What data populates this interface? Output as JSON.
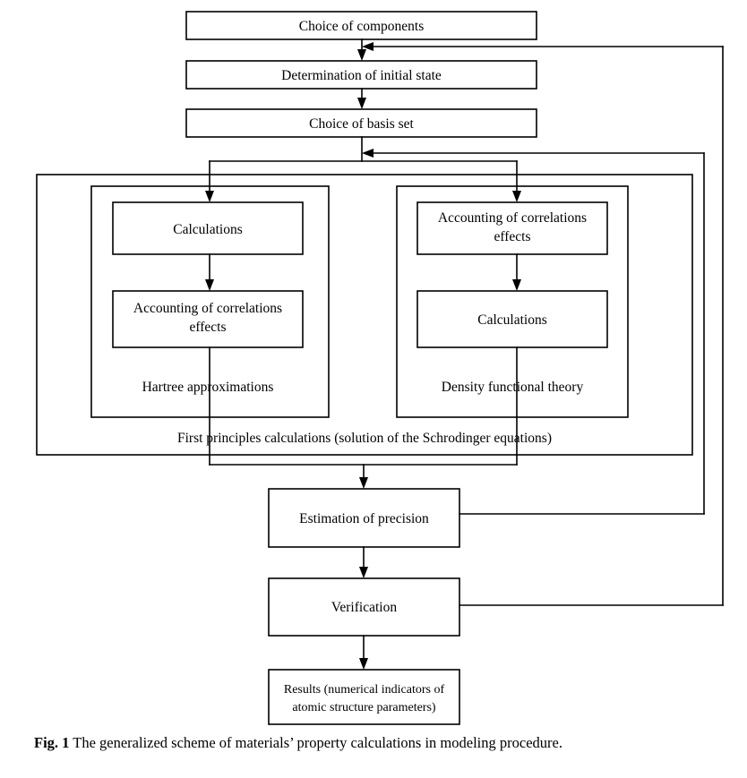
{
  "figure": {
    "caption_label": "Fig. 1",
    "caption_text": "The generalized scheme of materials’ property calculations in modeling procedure."
  },
  "nodes": {
    "choice_of_components": "Choice of components",
    "determination_of_initial_state": "Determination of initial state",
    "choice_of_basis_set": "Choice of basis set",
    "hartree_calculations": "Calculations",
    "hartree_correlations_line1": "Accounting of correlations",
    "hartree_correlations_line2": "effects",
    "dft_correlations_line1": "Accounting of correlations",
    "dft_correlations_line2": "effects",
    "dft_calculations": "Calculations",
    "estimation_of_precision": "Estimation of precision",
    "verification": "Verification",
    "results_line1": "Results (numerical indicators of",
    "results_line2": "atomic structure parameters)"
  },
  "panels": {
    "hartree_label": "Hartree approximations",
    "dft_label": "Density functional theory",
    "first_principles_label": "First principles calculations (solution of the Schrodinger equations)"
  },
  "chart_data": {
    "type": "diagram",
    "diagram_kind": "flowchart",
    "title": "The generalized scheme of materials’ property calculations in modeling procedure",
    "nodes": [
      {
        "id": "choice_of_components",
        "label": "Choice of components",
        "shape": "rect"
      },
      {
        "id": "determination_of_initial_state",
        "label": "Determination of initial state",
        "shape": "rect"
      },
      {
        "id": "choice_of_basis_set",
        "label": "Choice of basis set",
        "shape": "rect"
      },
      {
        "id": "hartree_calculations",
        "label": "Calculations",
        "shape": "rect",
        "group": "Hartree approximations"
      },
      {
        "id": "hartree_correlations",
        "label": "Accounting of correlations effects",
        "shape": "rect",
        "group": "Hartree approximations"
      },
      {
        "id": "dft_correlations",
        "label": "Accounting of correlations effects",
        "shape": "rect",
        "group": "Density functional theory"
      },
      {
        "id": "dft_calculations",
        "label": "Calculations",
        "shape": "rect",
        "group": "Density functional theory"
      },
      {
        "id": "estimation_of_precision",
        "label": "Estimation of precision",
        "shape": "rect"
      },
      {
        "id": "verification",
        "label": "Verification",
        "shape": "rect"
      },
      {
        "id": "results",
        "label": "Results (numerical indicators of atomic structure parameters)",
        "shape": "rect"
      }
    ],
    "groups": [
      {
        "id": "hartree",
        "label": "Hartree approximations"
      },
      {
        "id": "dft",
        "label": "Density functional theory"
      },
      {
        "id": "first_principles",
        "label": "First principles calculations (solution of the Schrodinger equations)",
        "contains": [
          "hartree",
          "dft"
        ]
      }
    ],
    "edges": [
      {
        "from": "choice_of_components",
        "to": "determination_of_initial_state",
        "kind": "arrow"
      },
      {
        "from": "determination_of_initial_state",
        "to": "choice_of_basis_set",
        "kind": "arrow"
      },
      {
        "from": "choice_of_basis_set",
        "to": "hartree_calculations",
        "kind": "arrow"
      },
      {
        "from": "choice_of_basis_set",
        "to": "dft_correlations",
        "kind": "arrow"
      },
      {
        "from": "hartree_calculations",
        "to": "hartree_correlations",
        "kind": "arrow"
      },
      {
        "from": "dft_correlations",
        "to": "dft_calculations",
        "kind": "arrow"
      },
      {
        "from": "hartree_correlations",
        "to": "estimation_of_precision",
        "kind": "arrow"
      },
      {
        "from": "dft_calculations",
        "to": "estimation_of_precision",
        "kind": "arrow"
      },
      {
        "from": "estimation_of_precision",
        "to": "verification",
        "kind": "arrow"
      },
      {
        "from": "verification",
        "to": "results",
        "kind": "arrow"
      },
      {
        "from": "estimation_of_precision",
        "to": "choice_of_basis_set",
        "kind": "feedback-arrow"
      },
      {
        "from": "verification",
        "to": "determination_of_initial_state",
        "kind": "feedback-arrow"
      }
    ]
  }
}
